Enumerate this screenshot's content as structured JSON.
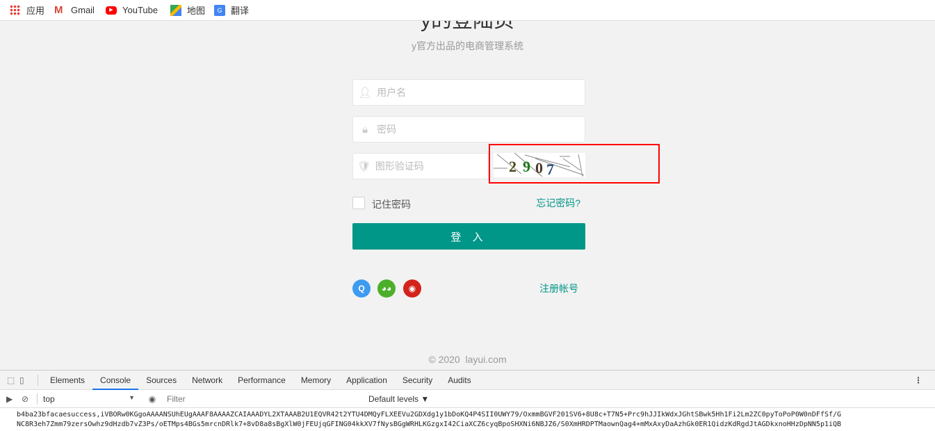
{
  "bookmarks": [
    {
      "label": "应用",
      "icon": "apps-grid-icon"
    },
    {
      "label": "Gmail",
      "icon": "gmail-icon"
    },
    {
      "label": "YouTube",
      "icon": "youtube-icon"
    },
    {
      "label": "地图",
      "icon": "maps-icon"
    },
    {
      "label": "翻译",
      "icon": "translate-icon"
    }
  ],
  "login": {
    "title": "y的登陆页",
    "subtitle": "y官方出品的电商管理系统",
    "username_placeholder": "用户名",
    "password_placeholder": "密码",
    "captcha_placeholder": "图形验证码",
    "captcha_text": "2907",
    "remember": "记住密码",
    "forgot": "忘记密码?",
    "submit": "登 入",
    "register": "注册帐号",
    "social": [
      "qq",
      "wechat",
      "weibo"
    ]
  },
  "footer": "© 2020  layui.com",
  "colors": {
    "accent": "#009688",
    "highlight": "#ff0000"
  },
  "devtools": {
    "tabs": [
      "Elements",
      "Console",
      "Sources",
      "Network",
      "Performance",
      "Memory",
      "Application",
      "Security",
      "Audits"
    ],
    "active_tab": "Console",
    "context": "top",
    "filter_placeholder": "Filter",
    "levels": "Default levels ▼",
    "log_lines": [
      "b4ba23bfacaesuccess,iVBORw0KGgoAAAANSUhEUgAAAF8AAAAZCAIAAADYL2XTAAAB2U1EQVR42t2YTU4DMQyFLXEEVu2GDXdg1y1bDoKQ4P4SII0UWY79/OxmmBGVF201SV6+8U8c+T7N5+Prc9hJJIkWdxJGhtSBwk5Hh1Fi2Lm2ZC0pyToPoP0W0nDFfSf/G",
      "NC8R3eh7Zmm79zersOwhz9dHzdb7vZ3Ps/oETMps4BGs5mrcnDRlk7+8vD8a8sBgXlW0jFEUjqGFING04kkXV7fNysBGgWRHLKGzgxI42CiaXCZ6cyqBpoSHXNi6NBJZ6/S0XmHRDPTMaownQag4+mMxAxyDaAzhGk0ER1QidzKdRgdJtAGDkxnoHHzDpNN5p1iQB"
    ]
  }
}
